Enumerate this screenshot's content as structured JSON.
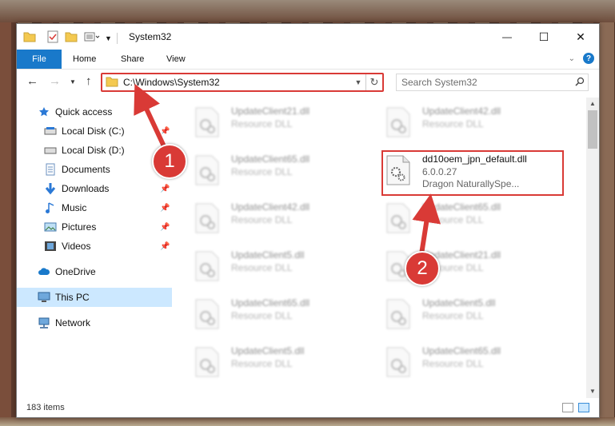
{
  "window": {
    "title": "System32",
    "minimize_glyph": "—",
    "maximize_glyph": "☐",
    "close_glyph": "✕"
  },
  "ribbon": {
    "file": "File",
    "tabs": [
      "Home",
      "Share",
      "View"
    ],
    "help": "?"
  },
  "nav": {
    "address": "C:\\Windows\\System32",
    "search_placeholder": "Search System32"
  },
  "sidebar": {
    "items": [
      {
        "label": "Quick access",
        "icon": "star-icon",
        "pinned": false
      },
      {
        "label": "Local Disk (C:)",
        "icon": "drive-icon",
        "pinned": true
      },
      {
        "label": "Local Disk (D:)",
        "icon": "drive-icon",
        "pinned": false
      },
      {
        "label": "Documents",
        "icon": "documents-icon",
        "pinned": true
      },
      {
        "label": "Downloads",
        "icon": "download-icon",
        "pinned": true
      },
      {
        "label": "Music",
        "icon": "music-icon",
        "pinned": true
      },
      {
        "label": "Pictures",
        "icon": "pictures-icon",
        "pinned": true
      },
      {
        "label": "Videos",
        "icon": "videos-icon",
        "pinned": true
      },
      {
        "label": "OneDrive",
        "icon": "cloud-icon",
        "pinned": false
      },
      {
        "label": "This PC",
        "icon": "computer-icon",
        "pinned": false,
        "selected": true
      },
      {
        "label": "Network",
        "icon": "network-icon",
        "pinned": false
      }
    ]
  },
  "files": {
    "left": [
      {
        "name": "UpdateClient21.dll",
        "desc": "Resource DLL"
      },
      {
        "name": "UpdateClient65.dll",
        "desc": "Resource DLL"
      },
      {
        "name": "UpdateClient42.dll",
        "desc": "Resource DLL"
      },
      {
        "name": "UpdateClient5.dll",
        "desc": "Resource DLL"
      },
      {
        "name": "UpdateClient65.dll",
        "desc": "Resource DLL"
      },
      {
        "name": "UpdateClient5.dll",
        "desc": "Resource DLL"
      }
    ],
    "right": [
      {
        "name": "UpdateClient42.dll",
        "desc": "Resource DLL"
      },
      {
        "name": "dd10oem_jpn_default.dll",
        "version": "6.0.0.27",
        "desc": "Dragon NaturallySpe..."
      },
      {
        "name": "UpdateClient65.dll",
        "desc": "Resource DLL"
      },
      {
        "name": "UpdateClient21.dll",
        "desc": "Resource DLL"
      },
      {
        "name": "UpdateClient5.dll",
        "desc": "Resource DLL"
      },
      {
        "name": "UpdateClient65.dll",
        "desc": "Resource DLL"
      }
    ]
  },
  "status": {
    "item_count": "183 items"
  },
  "callouts": [
    "1",
    "2"
  ],
  "colors": {
    "accent": "#1979ca",
    "highlight": "#d93a36",
    "selection": "#cce8ff"
  }
}
